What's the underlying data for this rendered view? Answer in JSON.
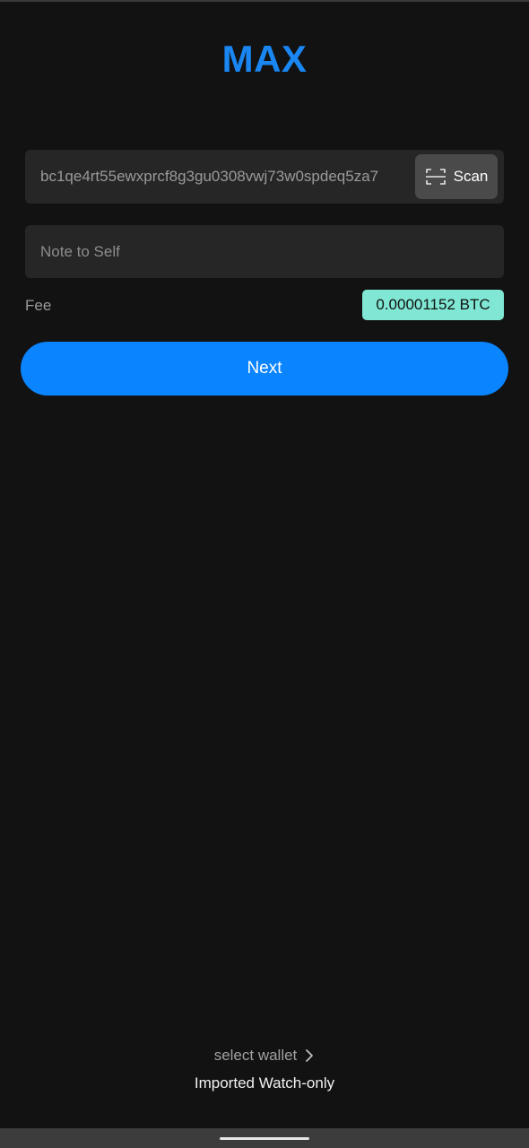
{
  "header": {
    "amount_label": "MAX"
  },
  "address_field": {
    "value": "bc1qe4rt55ewxprcf8g3gu0308vwj73w0spdeq5za7",
    "scan_label": "Scan"
  },
  "note_field": {
    "placeholder": "Note to Self"
  },
  "fee": {
    "label": "Fee",
    "value": "0.00001152 BTC"
  },
  "next_button": {
    "label": "Next"
  },
  "wallet_selector": {
    "label": "select wallet",
    "wallet_name": "Imported Watch-only"
  },
  "colors": {
    "background": "#121212",
    "accent": "#0a84ff",
    "fee_badge": "#7fe7d3",
    "field": "#262626"
  },
  "icons": {
    "scan": "scan-frame-icon",
    "chevron": "chevron-right-icon"
  }
}
